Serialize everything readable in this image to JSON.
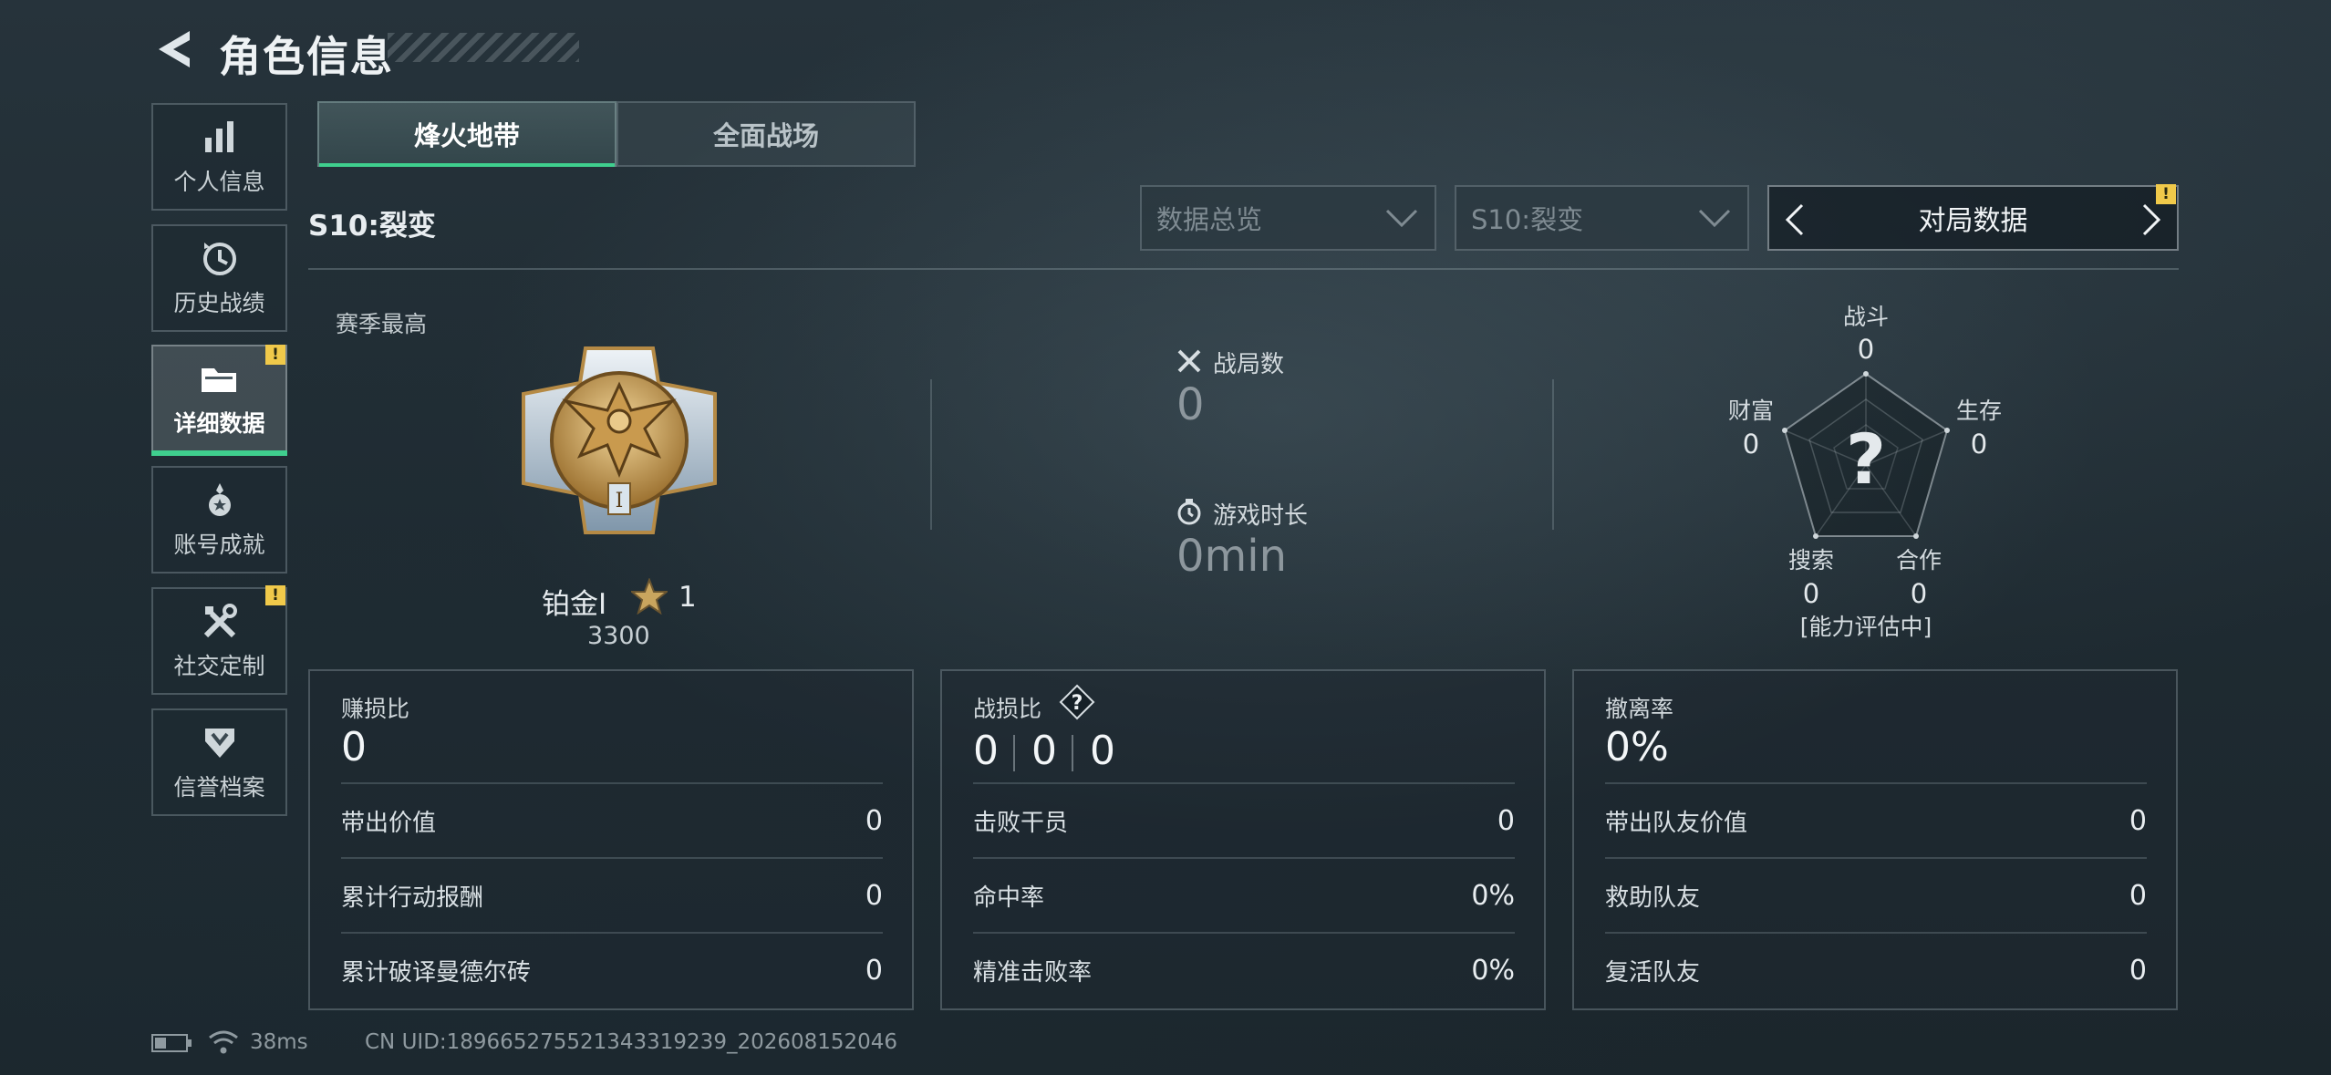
{
  "header": {
    "title": "角色信息"
  },
  "sidebar": {
    "items": [
      {
        "label": "个人信息",
        "icon": "bar-chart-icon"
      },
      {
        "label": "历史战绩",
        "icon": "clock-icon"
      },
      {
        "label": "详细数据",
        "icon": "folder-icon",
        "active": true,
        "badge": "!"
      },
      {
        "label": "账号成就",
        "icon": "medal-icon"
      },
      {
        "label": "社交定制",
        "icon": "tools-icon",
        "badge": "!"
      },
      {
        "label": "信誉档案",
        "icon": "shield-icon"
      }
    ]
  },
  "mode_tabs": [
    {
      "label": "烽火地带",
      "active": true
    },
    {
      "label": "全面战场",
      "active": false
    }
  ],
  "season_label": "S10:裂变",
  "filters": {
    "overview": "数据总览",
    "season": "S10:裂变",
    "view": "对局数据",
    "view_badge": "!"
  },
  "rank": {
    "label": "赛季最高",
    "name": "铂金Ⅰ",
    "stars": "1",
    "score": "3300",
    "emblem_numeral": "I"
  },
  "stats": {
    "matches_label": "战局数",
    "matches_value": "0",
    "playtime_label": "游戏时长",
    "playtime_value": "0min"
  },
  "radar": {
    "center_symbol": "?",
    "status": "[能力评估中]",
    "axes": [
      {
        "label": "战斗",
        "value": "0"
      },
      {
        "label": "生存",
        "value": "0"
      },
      {
        "label": "合作",
        "value": "0"
      },
      {
        "label": "搜索",
        "value": "0"
      },
      {
        "label": "财富",
        "value": "0"
      }
    ]
  },
  "cards": [
    {
      "title": "赚损比",
      "big": "0",
      "rows": [
        {
          "label": "带出价值",
          "value": "0"
        },
        {
          "label": "累计行动报酬",
          "value": "0"
        },
        {
          "label": "累计破译曼德尔砖",
          "value": "0"
        }
      ]
    },
    {
      "title": "战损比",
      "help": "?",
      "ratio": [
        "0",
        "0",
        "0"
      ],
      "rows": [
        {
          "label": "击败干员",
          "value": "0"
        },
        {
          "label": "命中率",
          "value": "0%"
        },
        {
          "label": "精准击败率",
          "value": "0%"
        }
      ]
    },
    {
      "title": "撤离率",
      "big": "0%",
      "rows": [
        {
          "label": "带出队友价值",
          "value": "0"
        },
        {
          "label": "救助队友",
          "value": "0"
        },
        {
          "label": "复活队友",
          "value": "0"
        }
      ]
    }
  ],
  "footer": {
    "ping": "38ms",
    "uid": "CN UID:18966527552134331923​9_202608152046"
  },
  "colors": {
    "accent_green": "#3fcf8e",
    "badge_yellow": "#f0c94a"
  }
}
